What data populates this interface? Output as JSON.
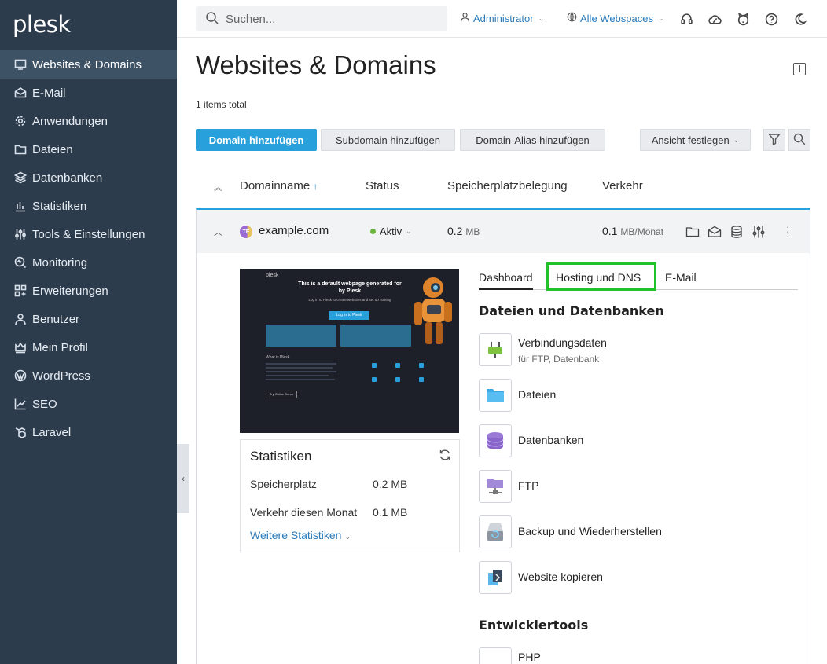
{
  "app": {
    "logo": "plesk"
  },
  "sidebar": {
    "items": [
      {
        "label": "Websites & Domains",
        "icon": "monitor-icon",
        "active": true
      },
      {
        "label": "E-Mail",
        "icon": "mail-icon"
      },
      {
        "label": "Anwendungen",
        "icon": "gear-icon"
      },
      {
        "label": "Dateien",
        "icon": "folder-icon"
      },
      {
        "label": "Datenbanken",
        "icon": "database-icon"
      },
      {
        "label": "Statistiken",
        "icon": "bar-chart-icon"
      },
      {
        "label": "Tools & Einstellungen",
        "icon": "sliders-icon"
      },
      {
        "label": "Monitoring",
        "icon": "monitoring-icon"
      },
      {
        "label": "Erweiterungen",
        "icon": "extensions-icon"
      },
      {
        "label": "Benutzer",
        "icon": "user-icon"
      },
      {
        "label": "Mein Profil",
        "icon": "profile-icon"
      },
      {
        "label": "WordPress",
        "icon": "wordpress-icon"
      },
      {
        "label": "SEO",
        "icon": "seo-icon"
      },
      {
        "label": "Laravel",
        "icon": "laravel-icon"
      }
    ],
    "collapse_glyph": "‹"
  },
  "topbar": {
    "search_placeholder": "Suchen...",
    "user_label": "Administrator",
    "webspaces_label": "Alle Webspaces"
  },
  "main": {
    "title": "Websites & Domains",
    "items_total": "1 items total",
    "buttons": {
      "add_domain": "Domain hinzufügen",
      "add_subdomain": "Subdomain hinzufügen",
      "add_alias": "Domain-Alias hinzufügen",
      "view": "Ansicht festlegen"
    },
    "columns": {
      "name": "Domainname",
      "sort_arrow": "↑",
      "status": "Status",
      "storage": "Speicherplatzbelegung",
      "traffic": "Verkehr"
    },
    "domain": {
      "name": "example.com",
      "icon_text": "TE",
      "status": "Aktiv",
      "storage_value": "0.2",
      "storage_unit": "MB",
      "traffic_value": "0.1",
      "traffic_unit": "MB/Monat"
    }
  },
  "preview": {
    "logo": "plesk",
    "heading": "This is a default webpage generated for by Plesk",
    "sub": "Log in to Plesk to create websites and set up hosting",
    "button": "Log in to Plesk",
    "what_is": "What is Plesk",
    "try_button": "Try Online Demo"
  },
  "stats": {
    "title": "Statistiken",
    "storage_label": "Speicherplatz",
    "storage_value": "0.2 MB",
    "traffic_label": "Verkehr diesen Monat",
    "traffic_value": "0.1 MB",
    "more_link": "Weitere Statistiken"
  },
  "tabs": {
    "dashboard": "Dashboard",
    "hosting": "Hosting und DNS",
    "email": "E-Mail"
  },
  "sections": {
    "files_db": "Dateien und Datenbanken",
    "dev_tools": "Entwicklertools"
  },
  "tools": [
    {
      "label": "Verbindungsdaten",
      "sub": "für FTP, Datenbank",
      "icon": "plug-icon"
    },
    {
      "label": "Dateien",
      "icon": "folder-icon"
    },
    {
      "label": "Datenbanken",
      "icon": "database-icon"
    },
    {
      "label": "FTP",
      "icon": "ftp-icon"
    },
    {
      "label": "Backup und Wiederherstellen",
      "icon": "backup-icon"
    },
    {
      "label": "Website kopieren",
      "icon": "copy-icon"
    },
    {
      "label": "PHP",
      "icon": "php-icon"
    }
  ],
  "colors": {
    "sidebar_bg": "#2d3c4d",
    "accent": "#28a0db",
    "highlight": "#22c22a",
    "status_green": "#6db33f"
  }
}
